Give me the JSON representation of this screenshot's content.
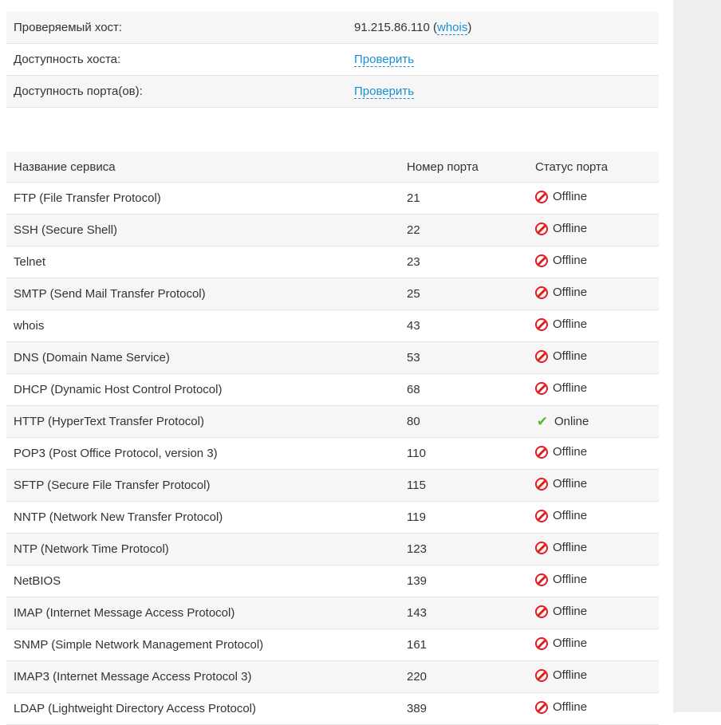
{
  "info": {
    "host_label": "Проверяемый хост:",
    "host_ip": "91.215.86.110",
    "whois_link": "whois",
    "host_availability_label": "Доступность хоста:",
    "host_check_link": "Проверить",
    "port_availability_label": "Доступность порта(ов):",
    "port_check_link": "Проверить"
  },
  "ports": {
    "headers": [
      "Название сервиса",
      "Номер порта",
      "Статус порта"
    ],
    "rows": [
      {
        "name": "FTP (File Transfer Protocol)",
        "port": "21",
        "status": "Offline"
      },
      {
        "name": "SSH (Secure Shell)",
        "port": "22",
        "status": "Offline"
      },
      {
        "name": "Telnet",
        "port": "23",
        "status": "Offline"
      },
      {
        "name": "SMTP (Send Mail Transfer Protocol)",
        "port": "25",
        "status": "Offline"
      },
      {
        "name": "whois",
        "port": "43",
        "status": "Offline"
      },
      {
        "name": "DNS (Domain Name Service)",
        "port": "53",
        "status": "Offline"
      },
      {
        "name": "DHCP (Dynamic Host Control Protocol)",
        "port": "68",
        "status": "Offline"
      },
      {
        "name": "HTTP (HyperText Transfer Protocol)",
        "port": "80",
        "status": "Online"
      },
      {
        "name": "POP3 (Post Office Protocol, version 3)",
        "port": "110",
        "status": "Offline"
      },
      {
        "name": "SFTP (Secure File Transfer Protocol)",
        "port": "115",
        "status": "Offline"
      },
      {
        "name": "NNTP (Network New Transfer Protocol)",
        "port": "119",
        "status": "Offline"
      },
      {
        "name": "NTP (Network Time Protocol)",
        "port": "123",
        "status": "Offline"
      },
      {
        "name": "NetBIOS",
        "port": "139",
        "status": "Offline"
      },
      {
        "name": "IMAP (Internet Message Access Protocol)",
        "port": "143",
        "status": "Offline"
      },
      {
        "name": "SNMP (Simple Network Management Protocol)",
        "port": "161",
        "status": "Offline"
      },
      {
        "name": "IMAP3 (Internet Message Access Protocol 3)",
        "port": "220",
        "status": "Offline"
      },
      {
        "name": "LDAP (Lightweight Directory Access Protocol)",
        "port": "389",
        "status": "Offline"
      }
    ]
  },
  "colors": {
    "link": "#1a8fd6",
    "offline": "#e02020",
    "online": "#5cb531",
    "row_alt": "#f6f6f6",
    "gutter": "#eeeeee"
  },
  "icons": {
    "offline": "no-entry-icon",
    "online": "checkmark-icon"
  }
}
